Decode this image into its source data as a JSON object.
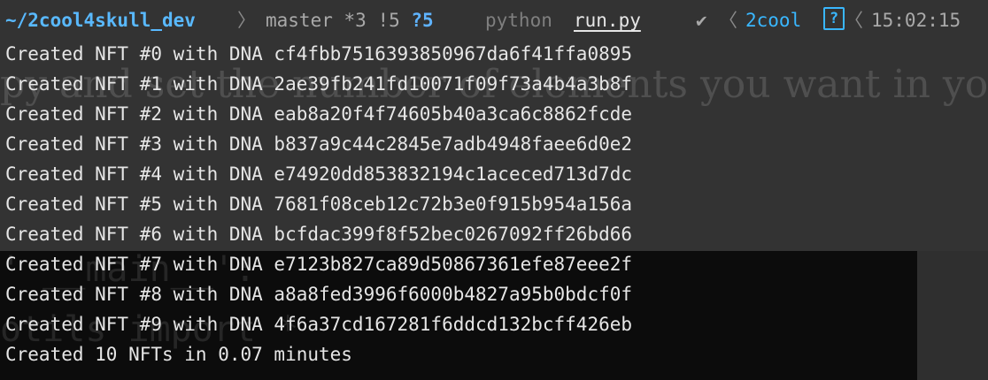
{
  "background": {
    "ghost_serif": "py and set the number of elements you want in your",
    "ghost_mono_1": "' __main__':",
    "ghost_mono_2": "otils import *"
  },
  "prompt": {
    "cwd": "~/2cool4skull_dev",
    "branch": "master",
    "git_status": "*3 !5",
    "git_untracked": "?5",
    "language": "python",
    "file": "run.py",
    "check": "✔",
    "host": "2cool",
    "help_box": "?",
    "time": "15:02:15",
    "separator": "〉",
    "separator_left": "〈",
    "colors": {
      "cwd": "#59b9ff",
      "host": "#39b7ff",
      "dim": "#a9a9a9"
    }
  },
  "output": [
    "Created NFT #0 with DNA cf4fbb7516393850967da6f41ffa0895",
    "Created NFT #1 with DNA 2ae39fb241fd10071f09f73a4b4a3b8f",
    "Created NFT #2 with DNA eab8a20f4f74605b40a3ca6c8862fcde",
    "Created NFT #3 with DNA b837a9c44c2845e7adb4948faee6d0e2",
    "Created NFT #4 with DNA e74920dd853832194c1aceced713d7dc",
    "Created NFT #5 with DNA 7681f08ceb12c72b3e0f915b954a156a",
    "Created NFT #6 with DNA bcfdac399f8f52bec0267092ff26bd66",
    "Created NFT #7 with DNA e7123b827ca89d50867361efe87eee2f",
    "Created NFT #8 with DNA a8a8fed3996f6000b4827a95b0bdcf0f",
    "Created NFT #9 with DNA 4f6a37cd167281f6ddcd132bcff426eb",
    "Created 10 NFTs in 0.07 minutes"
  ]
}
